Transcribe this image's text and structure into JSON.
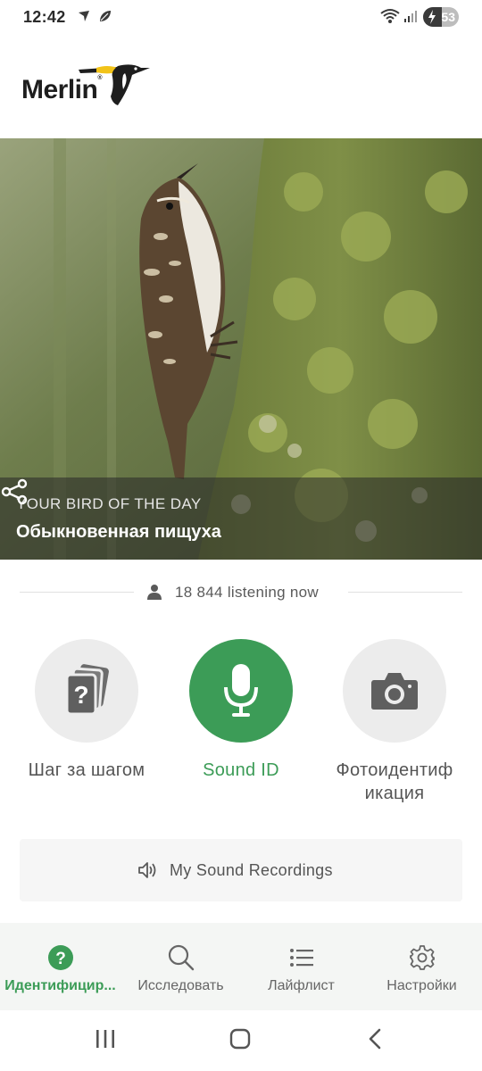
{
  "status_bar": {
    "time": "12:42",
    "battery": "53",
    "battery_level": 0.53,
    "icons": [
      "navigation-arrow-icon",
      "leaf-icon",
      "wifi-icon",
      "signal-icon",
      "battery-charging-icon"
    ]
  },
  "header": {
    "logo_text": "Merlin",
    "logo_reg": "®"
  },
  "hero": {
    "eyebrow": "YOUR BIRD OF THE DAY",
    "bird_name": "Обыкновенная пищуха"
  },
  "listening": {
    "text": "18 844 listening now"
  },
  "actions": [
    {
      "label": "Шаг за шагом",
      "icon": "question-cards-icon"
    },
    {
      "label": "Sound ID",
      "icon": "microphone-icon"
    },
    {
      "label": "Фотоидентиф икация",
      "icon": "camera-icon"
    }
  ],
  "recordings": {
    "label": "My Sound Recordings"
  },
  "bottom_nav": {
    "items": [
      {
        "label": "Идентифицир...",
        "icon": "question-circle-icon",
        "active": true
      },
      {
        "label": "Исследовать",
        "icon": "search-icon",
        "active": false
      },
      {
        "label": "Лайфлист",
        "icon": "list-icon",
        "active": false
      },
      {
        "label": "Настройки",
        "icon": "gear-icon",
        "active": false
      }
    ]
  },
  "colors": {
    "accent": "#3c9c57",
    "circle_bg": "#ececec",
    "nav_bg": "#f4f6f4"
  }
}
